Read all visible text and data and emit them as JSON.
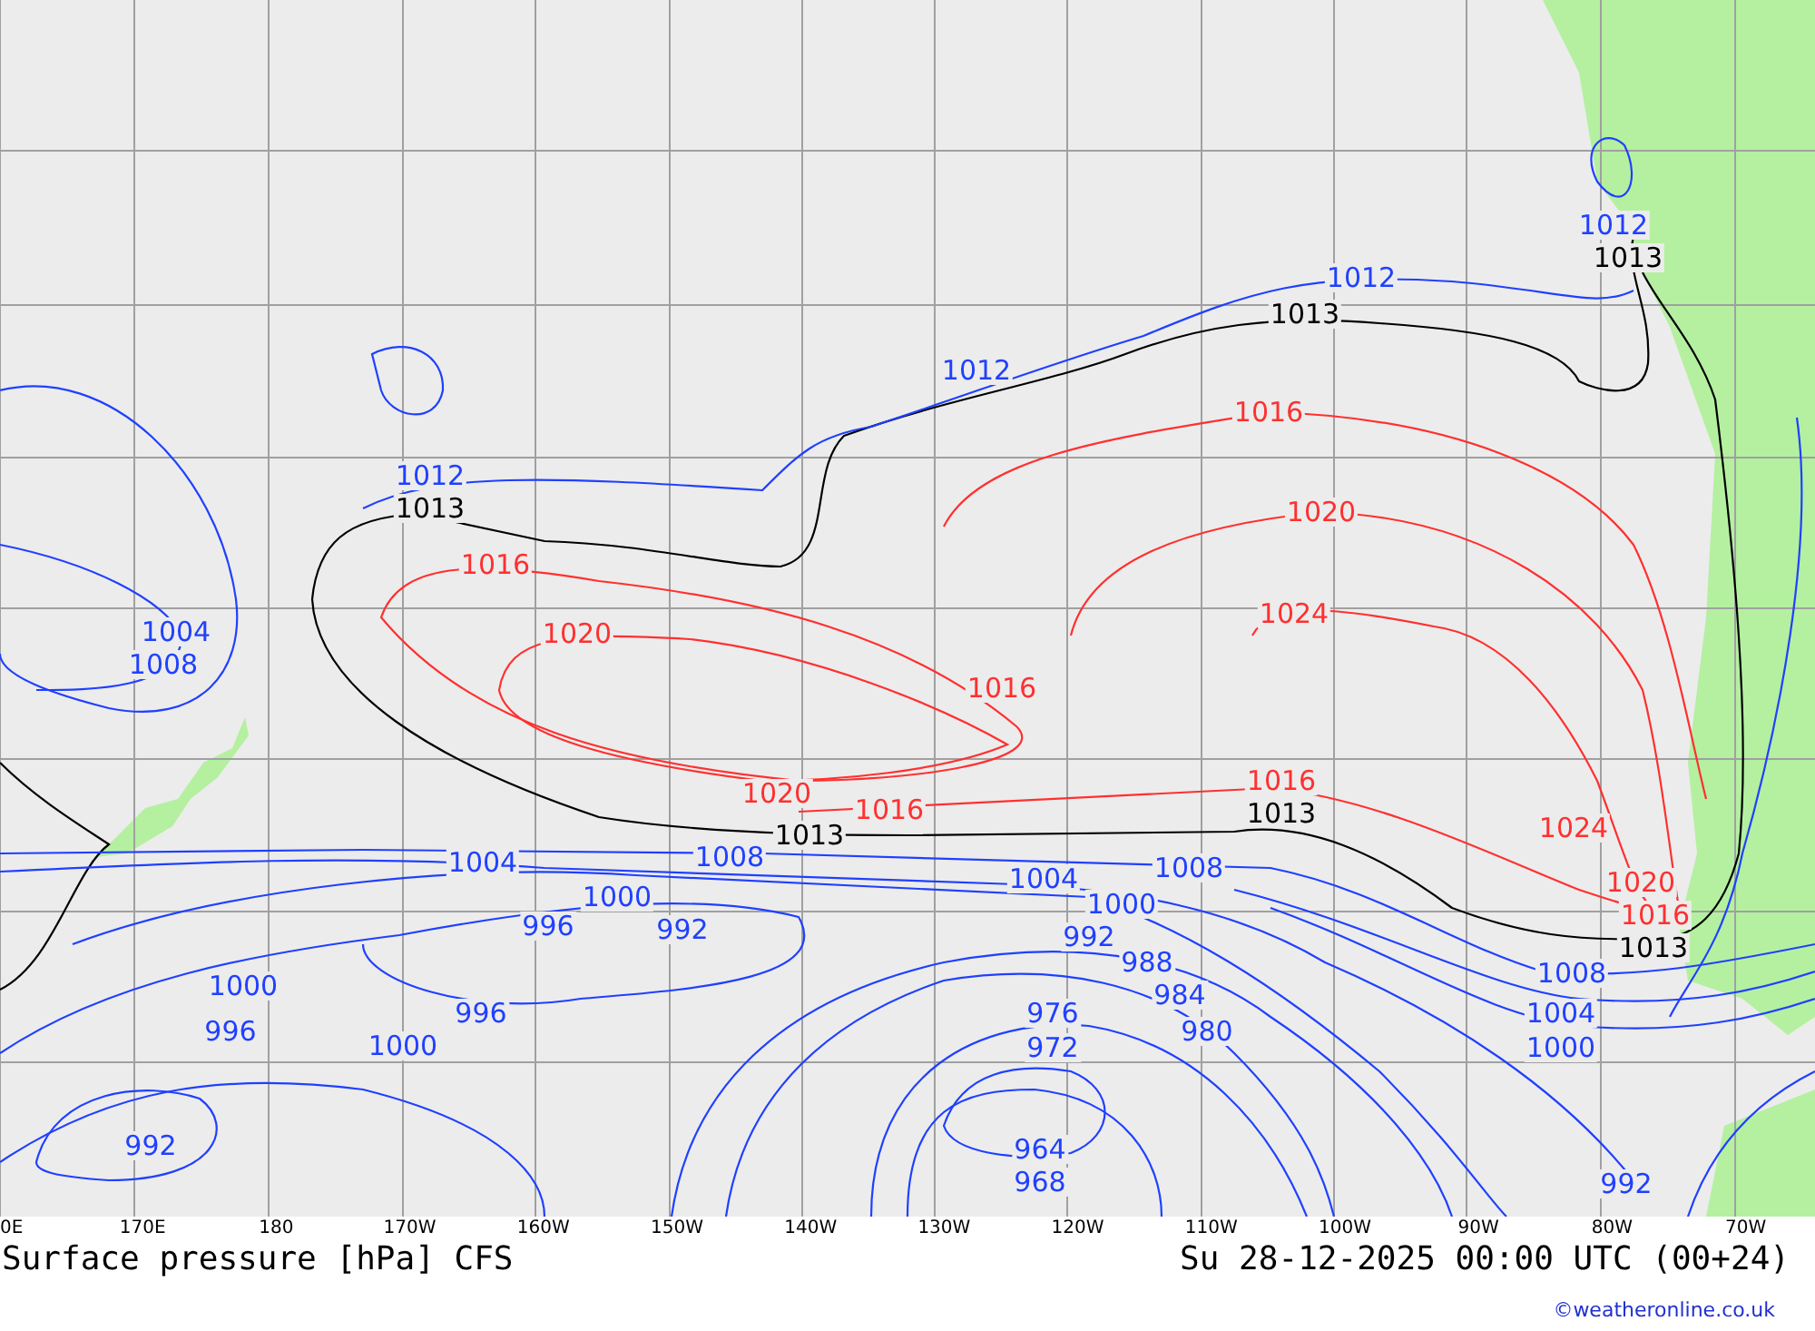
{
  "map": {
    "isobar_labels": [
      {
        "text": "1012",
        "color": "#2040ff"
      },
      {
        "text": "1013",
        "color": "#000000"
      },
      {
        "text": "1012",
        "color": "#2040ff"
      },
      {
        "text": "1013",
        "color": "#000000"
      },
      {
        "text": "1012",
        "color": "#2040ff"
      },
      {
        "text": "1016",
        "color": "#ff3030"
      },
      {
        "text": "1012",
        "color": "#2040ff"
      },
      {
        "text": "1013",
        "color": "#000000"
      },
      {
        "text": "1020",
        "color": "#ff3030"
      },
      {
        "text": "1016",
        "color": "#ff3030"
      },
      {
        "text": "1024",
        "color": "#ff3030"
      },
      {
        "text": "1004",
        "color": "#2040ff"
      },
      {
        "text": "1020",
        "color": "#ff3030"
      },
      {
        "text": "1008",
        "color": "#2040ff"
      },
      {
        "text": "1016",
        "color": "#ff3030"
      },
      {
        "text": "1016",
        "color": "#ff3030"
      },
      {
        "text": "1020",
        "color": "#ff3030"
      },
      {
        "text": "1016",
        "color": "#ff3030"
      },
      {
        "text": "1013",
        "color": "#000000"
      },
      {
        "text": "1024",
        "color": "#ff3030"
      },
      {
        "text": "1013",
        "color": "#000000"
      },
      {
        "text": "1004",
        "color": "#2040ff"
      },
      {
        "text": "1008",
        "color": "#2040ff"
      },
      {
        "text": "1008",
        "color": "#2040ff"
      },
      {
        "text": "1004",
        "color": "#2040ff"
      },
      {
        "text": "1020",
        "color": "#ff3030"
      },
      {
        "text": "1000",
        "color": "#2040ff"
      },
      {
        "text": "1000",
        "color": "#2040ff"
      },
      {
        "text": "1016",
        "color": "#ff3030"
      },
      {
        "text": "996",
        "color": "#2040ff"
      },
      {
        "text": "992",
        "color": "#2040ff"
      },
      {
        "text": "992",
        "color": "#2040ff"
      },
      {
        "text": "1013",
        "color": "#000000"
      },
      {
        "text": "988",
        "color": "#2040ff"
      },
      {
        "text": "1008",
        "color": "#2040ff"
      },
      {
        "text": "1000",
        "color": "#2040ff"
      },
      {
        "text": "984",
        "color": "#2040ff"
      },
      {
        "text": "996",
        "color": "#2040ff"
      },
      {
        "text": "976",
        "color": "#2040ff"
      },
      {
        "text": "1004",
        "color": "#2040ff"
      },
      {
        "text": "996",
        "color": "#2040ff"
      },
      {
        "text": "980",
        "color": "#2040ff"
      },
      {
        "text": "1000",
        "color": "#2040ff"
      },
      {
        "text": "972",
        "color": "#2040ff"
      },
      {
        "text": "1000",
        "color": "#2040ff"
      },
      {
        "text": "992",
        "color": "#2040ff"
      },
      {
        "text": "964",
        "color": "#2040ff"
      },
      {
        "text": "968",
        "color": "#2040ff"
      },
      {
        "text": "992",
        "color": "#2040ff"
      }
    ],
    "axis_labels": [
      "0E",
      "170E",
      "180",
      "170W",
      "160W",
      "150W",
      "140W",
      "130W",
      "120W",
      "110W",
      "100W",
      "90W",
      "80W",
      "70W"
    ]
  },
  "title": "Surface pressure [hPa] CFS",
  "valid_time": "Su 28-12-2025 00:00 UTC (00+24)",
  "copyright": "©weatheronline.co.uk"
}
